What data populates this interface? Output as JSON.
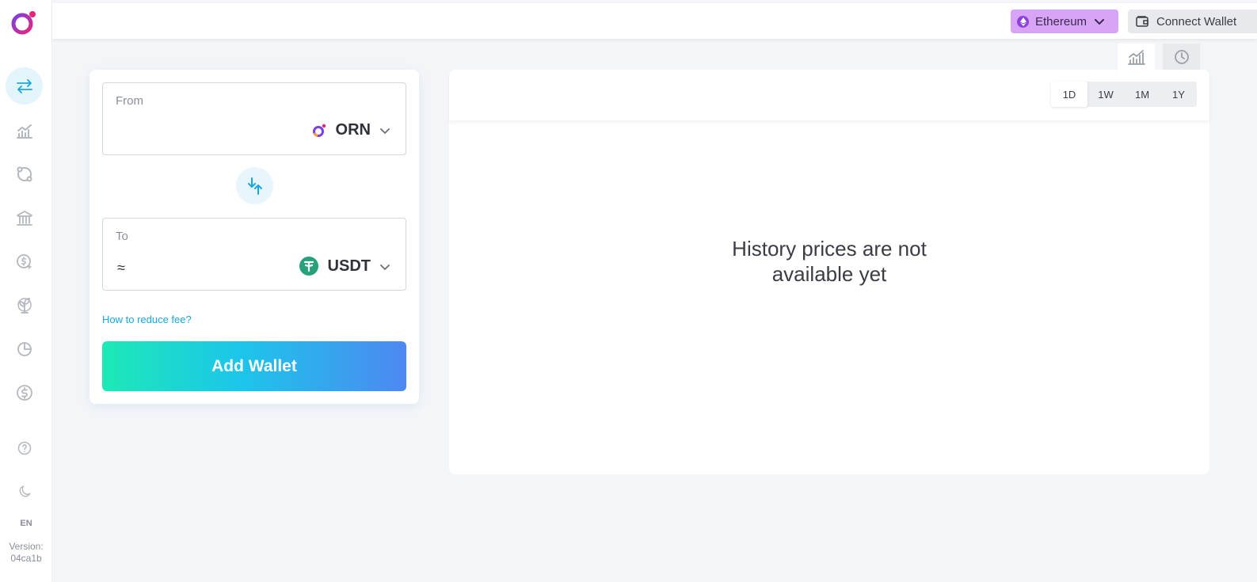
{
  "header": {
    "network": "Ethereum",
    "connect_label": "Connect Wallet"
  },
  "sidebar": {
    "items": [
      {
        "icon": "swap-icon",
        "active": true
      },
      {
        "icon": "chart-icon",
        "active": false
      },
      {
        "icon": "bridge-icon",
        "active": false
      },
      {
        "icon": "bank-icon",
        "active": false
      },
      {
        "icon": "dollar-plus-icon",
        "active": false
      },
      {
        "icon": "sprout-icon",
        "active": false
      },
      {
        "icon": "pie-chart-icon",
        "active": false
      },
      {
        "icon": "dollar-circle-icon",
        "active": false
      },
      {
        "icon": "help-icon",
        "active": false
      },
      {
        "icon": "moon-icon",
        "active": false
      }
    ],
    "lang": "EN",
    "version_label": "Version:",
    "version_value": "04ca1b"
  },
  "swap": {
    "from_label": "From",
    "from_token": "ORN",
    "to_label": "To",
    "to_prefix": "≈",
    "to_token": "USDT",
    "fee_link": "How to reduce fee?",
    "add_wallet": "Add Wallet"
  },
  "chart": {
    "periods": [
      "1D",
      "1W",
      "1M",
      "1Y"
    ],
    "active_period": "1D",
    "empty_line1": "History prices are not",
    "empty_line2": "available yet"
  },
  "colors": {
    "accent": "#17a8e0",
    "network_bg": "#d8a4f5",
    "usdt": "#26a17b"
  }
}
